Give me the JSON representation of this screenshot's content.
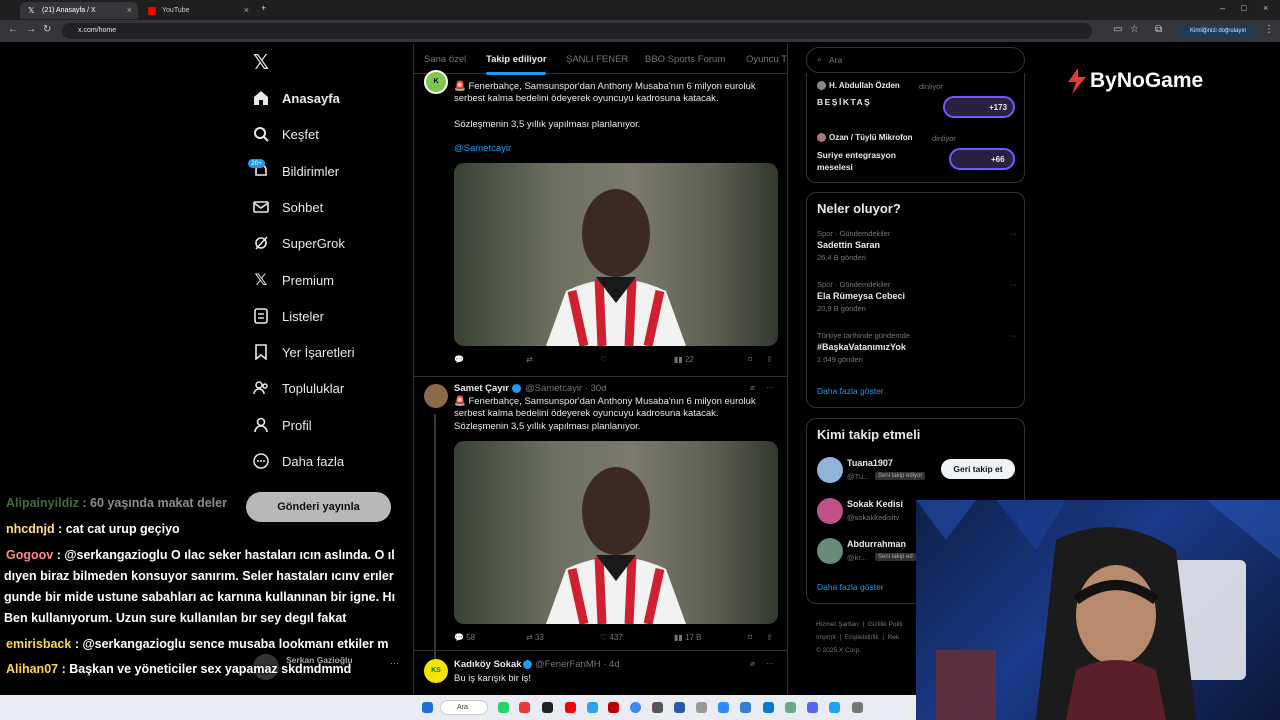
{
  "browser": {
    "tabs": [
      {
        "label": "(21) Anasayfa / X"
      },
      {
        "label": "YouTube"
      }
    ],
    "url": "x.com/home",
    "verify_label": "Kimliğinizi doğrulayın"
  },
  "nav": {
    "items": [
      {
        "label": "Anasayfa",
        "icon": "home-icon"
      },
      {
        "label": "Keşfet",
        "icon": "search-icon"
      },
      {
        "label": "Bildirimler",
        "icon": "bell-icon",
        "badge": "20+"
      },
      {
        "label": "Sohbet",
        "icon": "mail-icon"
      },
      {
        "label": "SuperGrok",
        "icon": "grok-icon"
      },
      {
        "label": "Premium",
        "icon": "x-logo-icon"
      },
      {
        "label": "Listeler",
        "icon": "list-icon"
      },
      {
        "label": "Yer İşaretleri",
        "icon": "bookmark-icon"
      },
      {
        "label": "Topluluklar",
        "icon": "communities-icon"
      },
      {
        "label": "Profil",
        "icon": "profile-icon"
      },
      {
        "label": "Daha fazla",
        "icon": "more-icon"
      }
    ],
    "post_button": "Gönderi yayınla",
    "account_name": "Serkan Gazioğlu"
  },
  "feed": {
    "tabs": [
      "Sana özel",
      "Takip ediliyor",
      "ŞANLI FENER",
      "BBO Sports Forum",
      "Oyuncu T"
    ],
    "post1": {
      "text1": "🚨 Fenerbahçe, Samsunspor'dan Anthony Musaba'nın 6 milyon euroluk serbest kalma bedelini ödeyerek oyuncuyu kadrosuna katacak.",
      "text2": "Sözleşmenin 3,5 yıllık yapılması planlanıyor.",
      "mention": "@Sametcayir",
      "views": "22"
    },
    "post2": {
      "name": "Samet Çayır",
      "handle": "@Sametcayir · 30d",
      "text1": "🚨 Fenerbahçe, Samsunspor'dan Anthony Musaba'nın 6 milyon euroluk serbest kalma bedelini ödeyerek oyuncuyu kadrosuna katacak.",
      "text2": "Sözleşmenin 3,5 yıllık yapılması planlanıyor.",
      "replies": "58",
      "reposts": "33",
      "likes": "437",
      "views": "17 B"
    },
    "post3": {
      "name": "Kadıköy Sokak",
      "handle": "@FenerFanMH · 4d",
      "text": "Bu iş karışık bir iş!",
      "avatar": "KS"
    }
  },
  "right": {
    "search_placeholder": "Ara",
    "spaces": [
      {
        "host": "H. Abdullah Özden",
        "status": "dinliyor",
        "title": "BEŞİKTAŞ",
        "count": "+173"
      },
      {
        "host": "Ozan / Tüylü Mikrofon",
        "status": "dinliyor",
        "title": "Suriye entegrasyon meselesi",
        "count": "+66"
      }
    ],
    "trends_title": "Neler oluyor?",
    "trends": [
      {
        "context": "Spor · Gündemdekiler",
        "topic": "Sadettin Saran",
        "posts": "26,4 B gönderi"
      },
      {
        "context": "Spor · Gündemdekiler",
        "topic": "Ela Rümeysa Cebeci",
        "posts": "20,9 B gönderi"
      },
      {
        "context": "Türkiye tarihinde gündemde",
        "topic": "#BaşkaVatanımızYok",
        "posts": "1.049 gönderi"
      }
    ],
    "show_more": "Daha fazla göster",
    "who_title": "Kimi takip etmeli",
    "who": [
      {
        "name": "Tuana1907",
        "handle": "@Tu...",
        "follows_you": "Seni takip ediyor",
        "button": "Geri takip et"
      },
      {
        "name": "Sokak Kedisi",
        "handle": "@sokakkedisitv"
      },
      {
        "name": "Abdurrahman",
        "handle": "@kr...",
        "follows_you": "Seni takip ed"
      }
    ],
    "who_show_more": "Daha fazla göster",
    "footer": [
      "Hizmet Şartları",
      "Gizlilik Politi",
      "Imprint",
      "Erişilebilirlik",
      "Rek",
      "© 2025 X Corp."
    ]
  },
  "brand": {
    "logo": "ByNoGame"
  },
  "chat": [
    {
      "user": "Alipainyildiz",
      "msg": ": 60 yaşında makat deler",
      "color": "#7fbf6a"
    },
    {
      "user": "nhcdnjd",
      "msg": ": cat cat urup geçiyo",
      "color": "#ffe082"
    },
    {
      "user": "Gogoov",
      "msg": ": @serkangazioglu O ılac seker hastaları ıcın aslında. O ıl",
      "color": "#ff8a8a"
    },
    {
      "user": "",
      "msg": "dıyen biraz bilmeden konsuyor sanırım. Seler hastaları ıcınv erıler",
      "color": ""
    },
    {
      "user": "",
      "msg": "gunde bir mide ustune sabahları ac karnına kullanınan bir igne. Hı",
      "color": ""
    },
    {
      "user": "",
      "msg": "Ben kullanıyorum. Uzun sure kullanılan bır sey degıl fakat",
      "color": ""
    },
    {
      "user": "emirisback",
      "msg": ": @serkangazioglu sence musaba lookmanı etkiler m",
      "color": "#ffd54f"
    },
    {
      "user": "Alihan07",
      "msg": ": Başkan ve yöneticiler sex yapamaz skdmdmmd",
      "color": "#ffd54f"
    }
  ],
  "taskbar": {
    "search": "Ara"
  }
}
